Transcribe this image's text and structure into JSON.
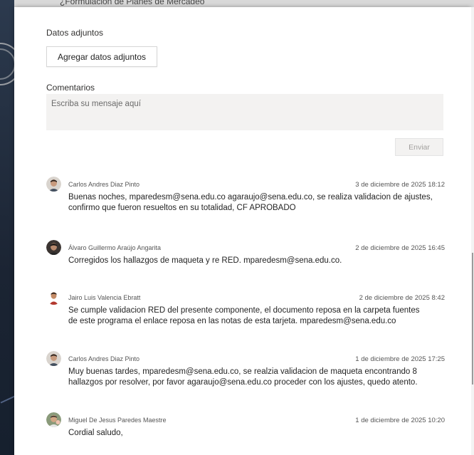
{
  "background": {
    "top_snippet": "¿Formulación de Planes de Mercadeo"
  },
  "attachments": {
    "label": "Datos adjuntos",
    "add_button": "Agregar datos adjuntos"
  },
  "comments_section": {
    "label": "Comentarios",
    "placeholder": "Escriba su mensaje aquí",
    "send_button": "Enviar"
  },
  "comments": [
    {
      "author": "Carlos Andres Diaz Pinto",
      "date": "3 de diciembre de 2025 18:12",
      "line1": "Buenas noches, mparedesm@sena.edu.co agaraujo@sena.edu.co, se realiza validacion de ajustes,",
      "line2": "confirmo que fueron resueltos en su totalidad, CF APROBADO"
    },
    {
      "author": "Álvaro Guillermo Araújo Angarita",
      "date": "2 de diciembre de 2025 16:45",
      "line1": "Corregidos los hallazgos de maqueta y re RED. mparedesm@sena.edu.co.",
      "line2": ""
    },
    {
      "author": "Jairo Luis Valencia Ebratt",
      "date": "2 de diciembre de 2025 8:42",
      "line1": "Se cumple validacion RED del presente componente, el documento reposa en la carpeta fuentes",
      "line2": "de este programa el enlace reposa en las notas de esta tarjeta. mparedesm@sena.edu.co"
    },
    {
      "author": "Carlos Andres Diaz Pinto",
      "date": "1 de diciembre de 2025 17:25",
      "line1": "Muy buenas tardes, mparedesm@sena.edu.co, se realzia validacion de maqueta encontrando 8",
      "line2": "hallazgos por resolver, por favor agaraujo@sena.edu.co proceder con los ajustes, quedo atento."
    },
    {
      "author": "Miguel De Jesus Paredes Maestre",
      "date": "1 de diciembre de 2025 10:20",
      "line1": "Cordial saludo,",
      "line2": ""
    }
  ],
  "colors": {
    "panel_bg": "#ffffff",
    "input_bg": "#f3f2f1",
    "text": "#242424",
    "muted": "#555555"
  }
}
